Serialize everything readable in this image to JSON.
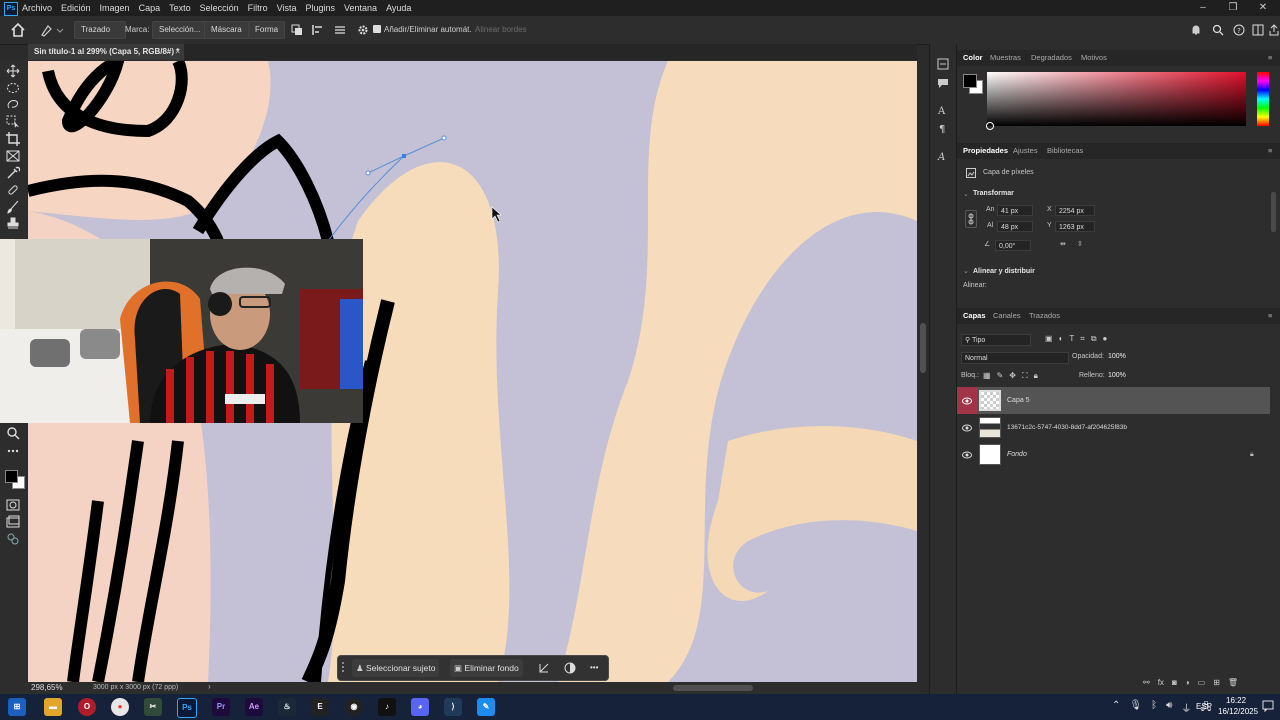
{
  "app": {
    "logo": "Ps",
    "brand_color": "#31a8ff"
  },
  "menu": [
    "Archivo",
    "Edición",
    "Imagen",
    "Capa",
    "Texto",
    "Selección",
    "Filtro",
    "Vista",
    "Plugins",
    "Ventana",
    "Ayuda"
  ],
  "window_controls": {
    "minimize": "–",
    "restore": "❐",
    "close": "✕"
  },
  "options": {
    "mode_value": "Trazado",
    "make_label": "Marca:",
    "selection_btn": "Selección...",
    "mask_btn": "Máscara",
    "shape_btn": "Forma",
    "auto_add_label": "Añadir/Eliminar automát.",
    "align_edges_label": "Alinear bordes"
  },
  "document": {
    "tab_title": "Sin título-1 al 299% (Capa 5, RGB/8#) *",
    "close": "×"
  },
  "status": {
    "zoom": "298,65%",
    "doc_info": "3000 px x 3000 px (72 ppp)",
    "arrow": "›"
  },
  "context_bar": {
    "select_subject": "Seleccionar sujeto",
    "remove_bg": "Eliminar fondo",
    "more": "•••"
  },
  "color_panel": {
    "tabs": [
      "Color",
      "Muestras",
      "Degradados",
      "Motivos"
    ],
    "hue": "#e0102a"
  },
  "properties": {
    "tabs": [
      "Propiedades",
      "Ajustes",
      "Bibliotecas"
    ],
    "layer_type": "Capa de píxeles",
    "transform_title": "Transformar",
    "w_label": "An",
    "w_value": "41 px",
    "h_label": "Al",
    "h_value": "48 px",
    "x_label": "X",
    "x_value": "2254 px",
    "y_label": "Y",
    "y_value": "1263 px",
    "angle_value": "0,00°",
    "align_title": "Alinear y distribuir",
    "align_label": "Alinear:"
  },
  "layers_panel": {
    "tabs": [
      "Capas",
      "Canales",
      "Trazados"
    ],
    "filter_kind": "Tipo",
    "blend_mode": "Normal",
    "opacity_label": "Opacidad:",
    "opacity_value": "100%",
    "lock_label": "Bloq.:",
    "fill_label": "Relleno:",
    "fill_value": "100%",
    "layers": [
      {
        "name": "Capa 5"
      },
      {
        "name": "13671c2c-5747-4030-8dd7-af204625f83b"
      },
      {
        "name": "Fondo"
      }
    ]
  },
  "taskbar": {
    "lang": "ESP",
    "time": "16:22",
    "date": "16/12/2025"
  }
}
